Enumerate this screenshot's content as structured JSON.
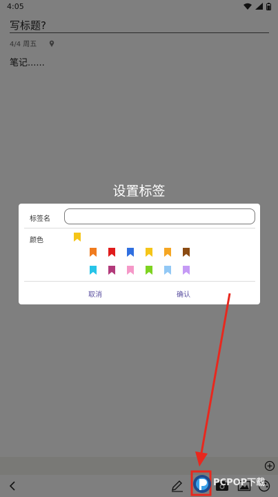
{
  "status_bar": {
    "time": "4:05"
  },
  "note": {
    "title_placeholder": "写标题?",
    "date": "4/4 周五",
    "body_placeholder": "笔记......"
  },
  "dialog": {
    "title": "设置标签",
    "name_label": "标签名",
    "name_value": "",
    "color_label": "颜色",
    "selected_color": "#f5c518",
    "colors_row1": [
      "#f07b1e",
      "#e01c1c",
      "#2f6fe0",
      "#f5c518",
      "#f5a623",
      "#8b4b12"
    ],
    "colors_row2": [
      "#27c4e8",
      "#b23a7a",
      "#f598c8",
      "#7ed321",
      "#92c8f5",
      "#c59af5"
    ],
    "cancel_label": "取消",
    "confirm_label": "确认",
    "button_color": "#5a4fa0"
  },
  "watermark": {
    "text": "PCPOP下载"
  },
  "accent": {
    "arrow": "#e8281e"
  }
}
